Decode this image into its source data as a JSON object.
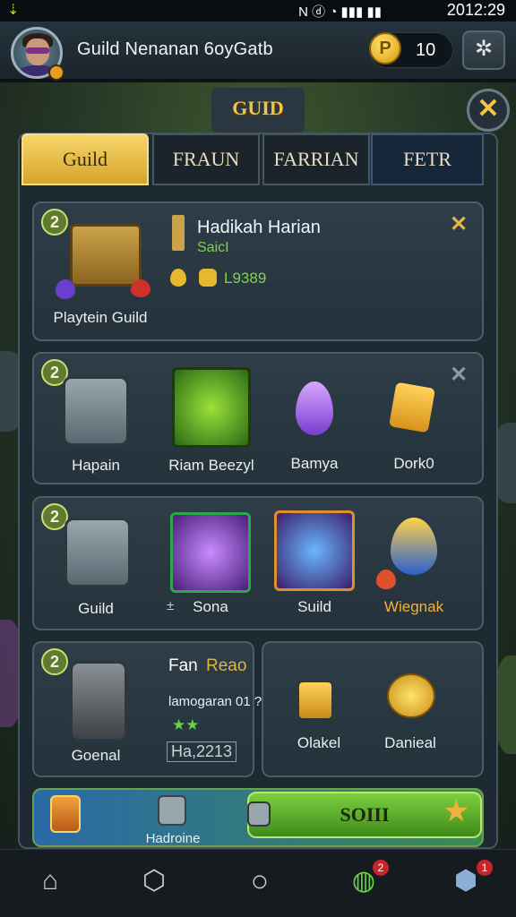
{
  "status_bar": {
    "time": "2012:29",
    "icons": "N ⓓ ◔ ▮▮▮ ▮▮"
  },
  "header": {
    "title": "Guild Nenanan 6oyGatb",
    "coin_symbol": "P",
    "coin_count": "10",
    "settings_icon": "✲"
  },
  "scene": {
    "gate_label": "GUID",
    "close_symbol": "✕"
  },
  "tabs": [
    "Guild",
    "FRAUN",
    "FARRIAN",
    "FETR"
  ],
  "cards": {
    "c1": {
      "level": "2",
      "label": "Playtein Guild",
      "heading": "Hadikah Harian",
      "subtext": "SaicI",
      "reward": "L9389",
      "close": "✕"
    },
    "c2": {
      "level": "2",
      "items": [
        "Hapain",
        "Riam Beezyl",
        "Bamya",
        "Dork0"
      ],
      "close": "✕"
    },
    "c3": {
      "level": "2",
      "items": [
        "Guild",
        "Sona",
        "Suild",
        "Wiegnak"
      ],
      "prefix": "±"
    },
    "c4": {
      "level": "2",
      "label": "Goenal",
      "title_a": "Fan",
      "title_b": "Reao",
      "line1": "lamogaran 01 ?",
      "stars": "★★",
      "stamp": "Ha,2213",
      "items": [
        "Olakel",
        "Danieal"
      ]
    }
  },
  "bottom_strip": {
    "label": "Hadroine",
    "button": "SOIII"
  },
  "nav": {
    "items": [
      "home",
      "shield",
      "circle",
      "pet",
      "gear-shield"
    ],
    "badge_pet": "2",
    "badge_gear": "1"
  },
  "colors": {
    "gold": "#f4c542",
    "panel": "#1e2a32",
    "green": "#7ccf3f"
  }
}
